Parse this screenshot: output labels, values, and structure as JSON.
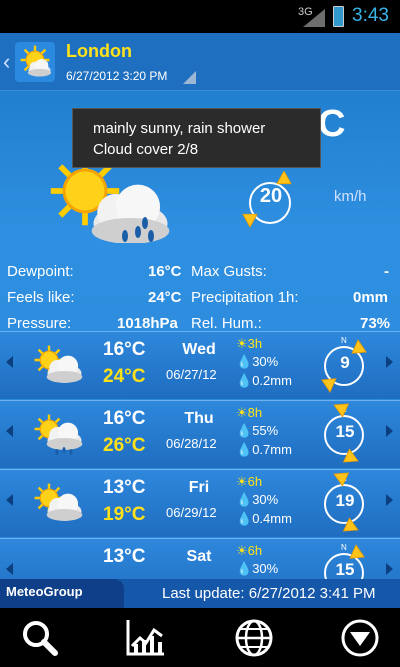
{
  "status_bar": {
    "signal": "3G",
    "time": "3:43"
  },
  "header": {
    "city": "London",
    "date": "6/27/2012 3:20 PM"
  },
  "tooltip": {
    "line1": "mainly sunny, rain shower",
    "line2": "Cloud cover 2/8"
  },
  "current": {
    "temp": "C",
    "wind": "20",
    "wind_unit": "km/h",
    "weather_icon": "sun-cloud-rain-icon"
  },
  "stats": {
    "dewpoint_label": "Dewpoint:",
    "dewpoint": "16°C",
    "feels_label": "Feels like:",
    "feels": "24°C",
    "pressure_label": "Pressure:",
    "pressure": "1018hPa",
    "gusts_label": "Max Gusts:",
    "gusts": "-",
    "precip_label": "Precipitation 1h:",
    "precip": "0mm",
    "hum_label": "Rel. Hum.:",
    "hum": "73%"
  },
  "days": [
    {
      "tmin": "16°C",
      "tmax": "24°C",
      "dow": "Wed",
      "date": "06/27/12",
      "sun": "3h",
      "rain_pct": "30%",
      "rain_mm": "0.2mm",
      "wind": "9",
      "icon": "sun-cloud-icon"
    },
    {
      "tmin": "16°C",
      "tmax": "26°C",
      "dow": "Thu",
      "date": "06/28/12",
      "sun": "8h",
      "rain_pct": "55%",
      "rain_mm": "0.7mm",
      "wind": "15",
      "icon": "sun-cloud-rain-icon"
    },
    {
      "tmin": "13°C",
      "tmax": "19°C",
      "dow": "Fri",
      "date": "06/29/12",
      "sun": "6h",
      "rain_pct": "30%",
      "rain_mm": "0.4mm",
      "wind": "19",
      "icon": "sun-cloud-icon"
    },
    {
      "tmin": "13°C",
      "tmax": "",
      "dow": "Sat",
      "date": "",
      "sun": "6h",
      "rain_pct": "30%",
      "rain_mm": "",
      "wind": "15",
      "icon": "sun-cloud-icon"
    }
  ],
  "footer": {
    "brand": "MeteoGroup",
    "last_update": "Last update: 6/27/2012 3:41 PM"
  },
  "nav": [
    "search-icon",
    "chart-icon",
    "globe-icon",
    "menu-down-icon"
  ],
  "colors": {
    "accent_yellow": "#ffe11a",
    "panel_blue": "#2a86d8",
    "status_blue": "#39b3e6"
  }
}
